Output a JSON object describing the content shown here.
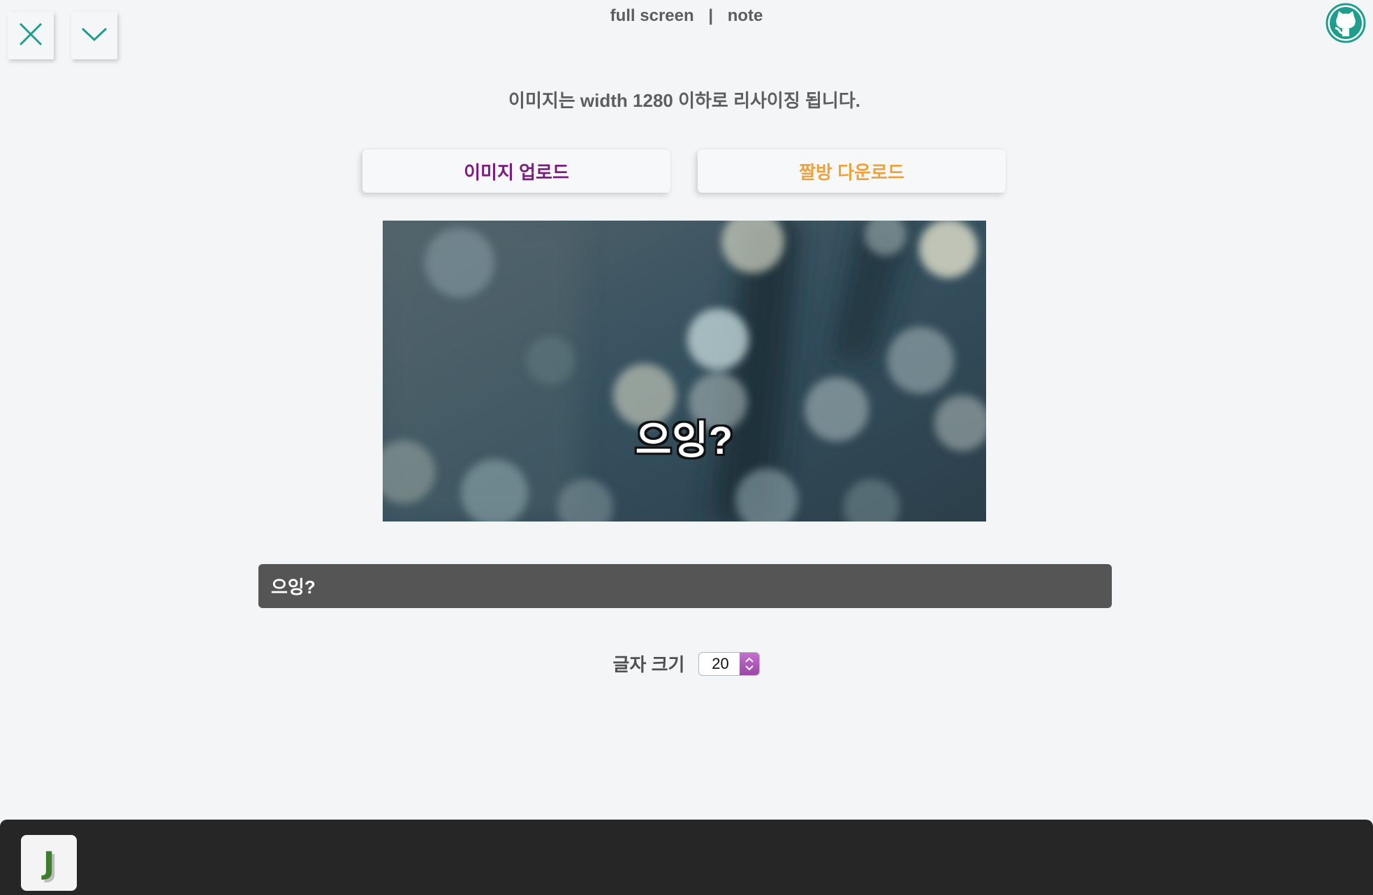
{
  "window": {
    "close_icon": "close-icon",
    "collapse_icon": "chevron-down-icon"
  },
  "nav": {
    "full_screen": "full screen",
    "separator": "|",
    "note": "note"
  },
  "header": {
    "info": "이미지는 width 1280 이하로 리사이징 됩니다."
  },
  "actions": {
    "upload_label": "이미지 업로드",
    "download_label": "짤방 다운로드"
  },
  "preview": {
    "caption": "으잉?"
  },
  "caption_input": {
    "value": "으잉?"
  },
  "font_size": {
    "label": "글자 크기",
    "value": "20"
  },
  "dock": {
    "app_letter": "J"
  },
  "colors": {
    "accent_teal": "#1f9e8e",
    "upload_text": "#7b1c7f",
    "download_text": "#f0a23a",
    "caption_bg": "#555555",
    "dock_bg": "#262626"
  }
}
